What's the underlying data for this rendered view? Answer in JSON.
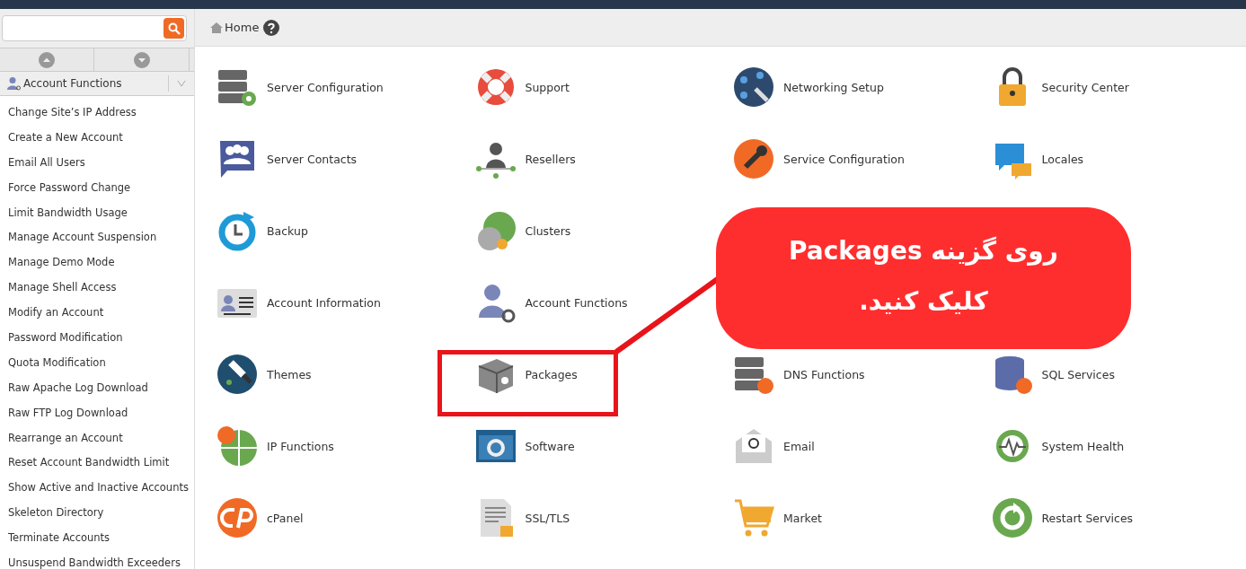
{
  "breadcrumb": {
    "label": "Home"
  },
  "sidebar": {
    "title": "Account Functions",
    "items": [
      {
        "label": "Change Site’s IP Address"
      },
      {
        "label": "Create a New Account"
      },
      {
        "label": "Email All Users"
      },
      {
        "label": "Force Password Change"
      },
      {
        "label": "Limit Bandwidth Usage"
      },
      {
        "label": "Manage Account Suspension"
      },
      {
        "label": "Manage Demo Mode"
      },
      {
        "label": "Manage Shell Access"
      },
      {
        "label": "Modify an Account"
      },
      {
        "label": "Password Modification"
      },
      {
        "label": "Quota Modification"
      },
      {
        "label": "Raw Apache Log Download"
      },
      {
        "label": "Raw FTP Log Download"
      },
      {
        "label": "Rearrange an Account"
      },
      {
        "label": "Reset Account Bandwidth Limit"
      },
      {
        "label": "Show Active and Inactive Accounts"
      },
      {
        "label": "Skeleton Directory"
      },
      {
        "label": "Terminate Accounts"
      },
      {
        "label": "Unsuspend Bandwidth Exceeders"
      }
    ]
  },
  "group_rows": [
    [
      {
        "label": "Server Configuration"
      },
      {
        "label": "Support"
      },
      {
        "label": "Networking Setup"
      },
      {
        "label": "Security Center"
      }
    ],
    [
      {
        "label": "Server Contacts"
      },
      {
        "label": "Resellers"
      },
      {
        "label": "Service Configuration"
      },
      {
        "label": "Locales"
      }
    ],
    [
      {
        "label": "Backup"
      },
      {
        "label": "Clusters"
      }
    ],
    [
      {
        "label": "Account Information"
      },
      {
        "label": "Account Functions"
      }
    ],
    [
      {
        "label": "Themes"
      },
      {
        "label": "Packages"
      },
      {
        "label": "DNS Functions"
      },
      {
        "label": "SQL Services"
      }
    ],
    [
      {
        "label": "IP Functions"
      },
      {
        "label": "Software"
      },
      {
        "label": "Email"
      },
      {
        "label": "System Health"
      }
    ],
    [
      {
        "label": "cPanel"
      },
      {
        "label": "SSL/TLS"
      },
      {
        "label": "Market"
      },
      {
        "label": "Restart Services"
      }
    ]
  ],
  "callout": {
    "text": "روی گزینه Packages کلیک کنید."
  }
}
